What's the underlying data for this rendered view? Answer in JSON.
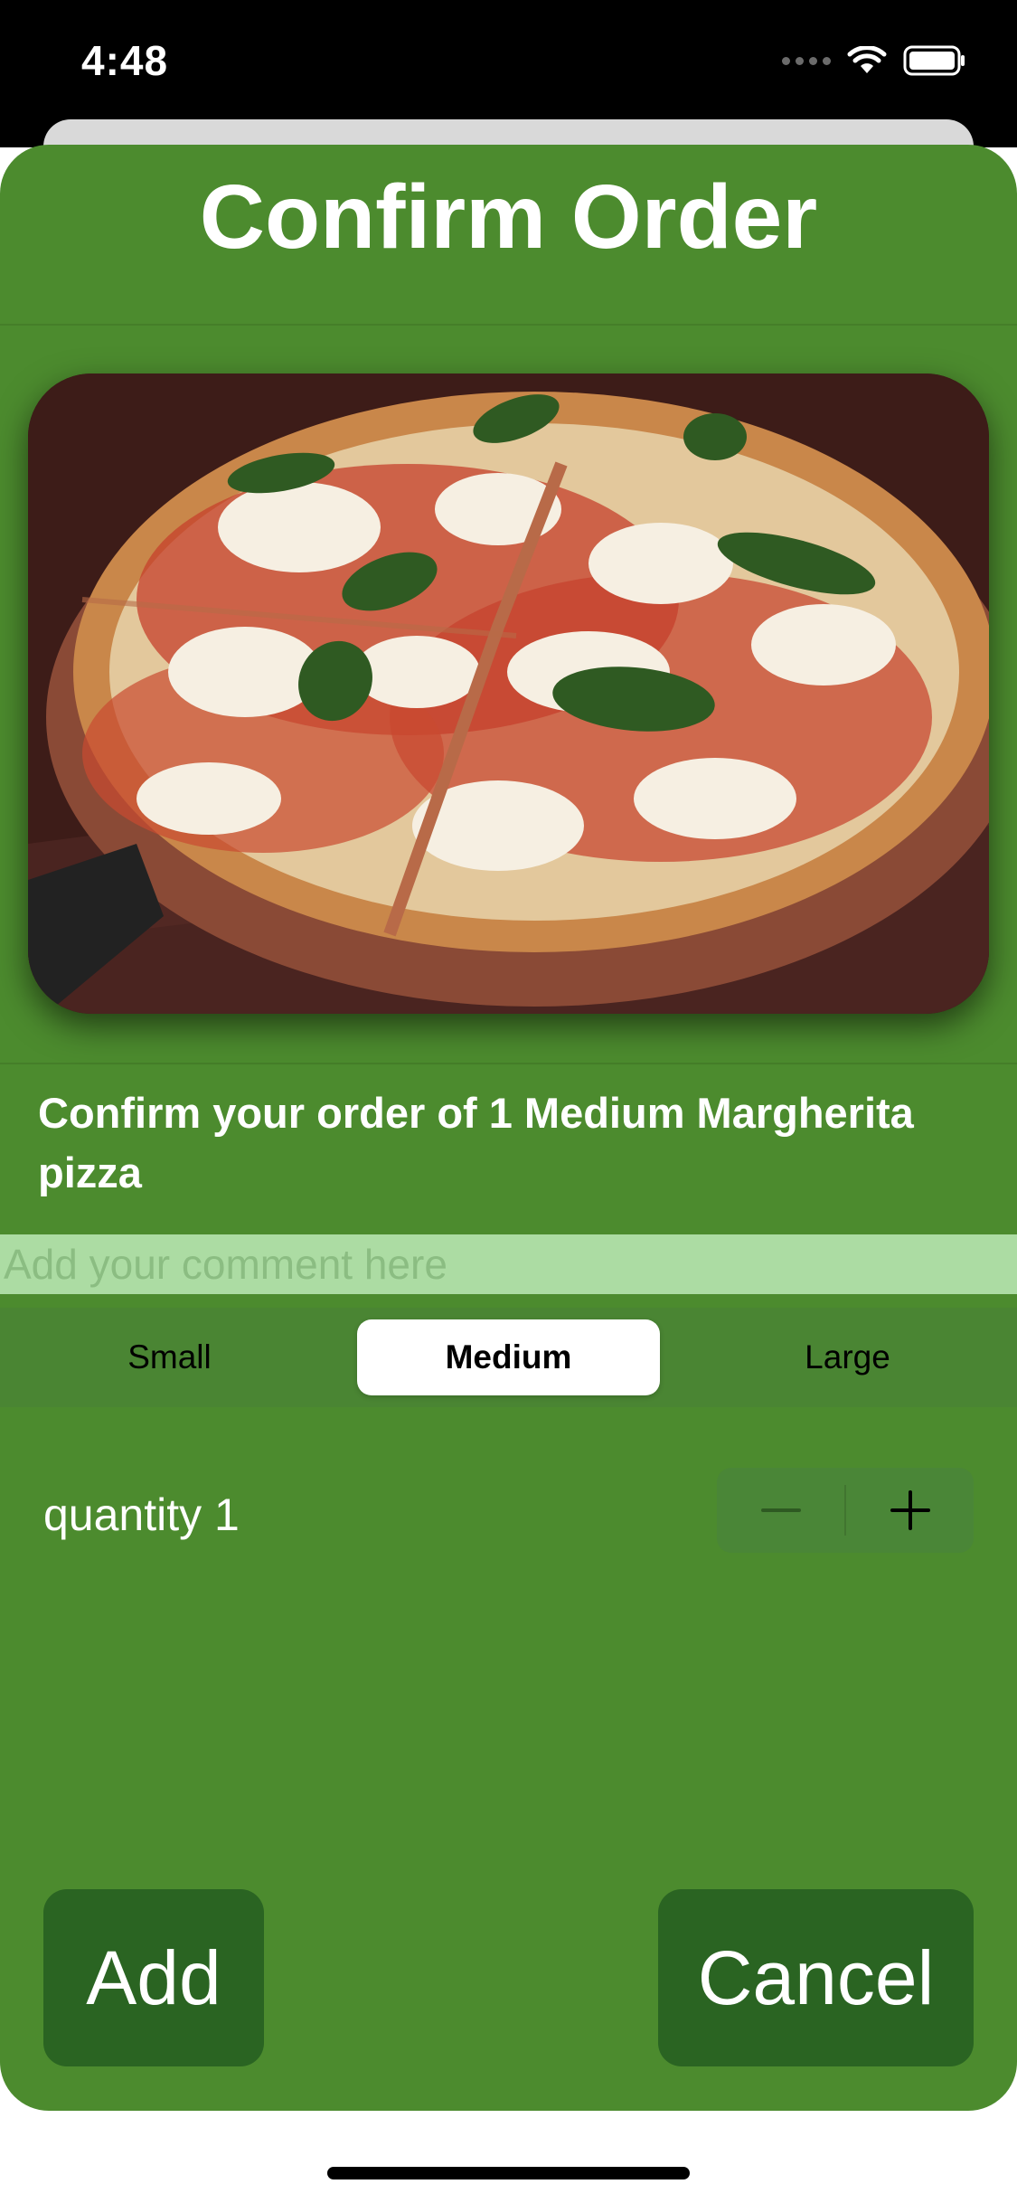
{
  "status_bar": {
    "time": "4:48",
    "icons": [
      "signal-dots-icon",
      "wifi-icon",
      "battery-icon"
    ]
  },
  "sheet": {
    "title": "Confirm Order",
    "image_subject": "margherita-pizza-photo",
    "order_summary": "Confirm your order of 1 Medium Margherita pizza",
    "comment": {
      "value": "",
      "placeholder": "Add your comment here"
    },
    "sizes": {
      "options": [
        "Small",
        "Medium",
        "Large"
      ],
      "selected": "Medium"
    },
    "quantity": {
      "label": "quantity 1",
      "value": 1
    },
    "buttons": {
      "add": "Add",
      "cancel": "Cancel"
    }
  },
  "colors": {
    "sheet_background": "#4c8b2e",
    "comment_field": "#acdca3",
    "button_background": "#2a6422",
    "text": "#ffffff"
  }
}
